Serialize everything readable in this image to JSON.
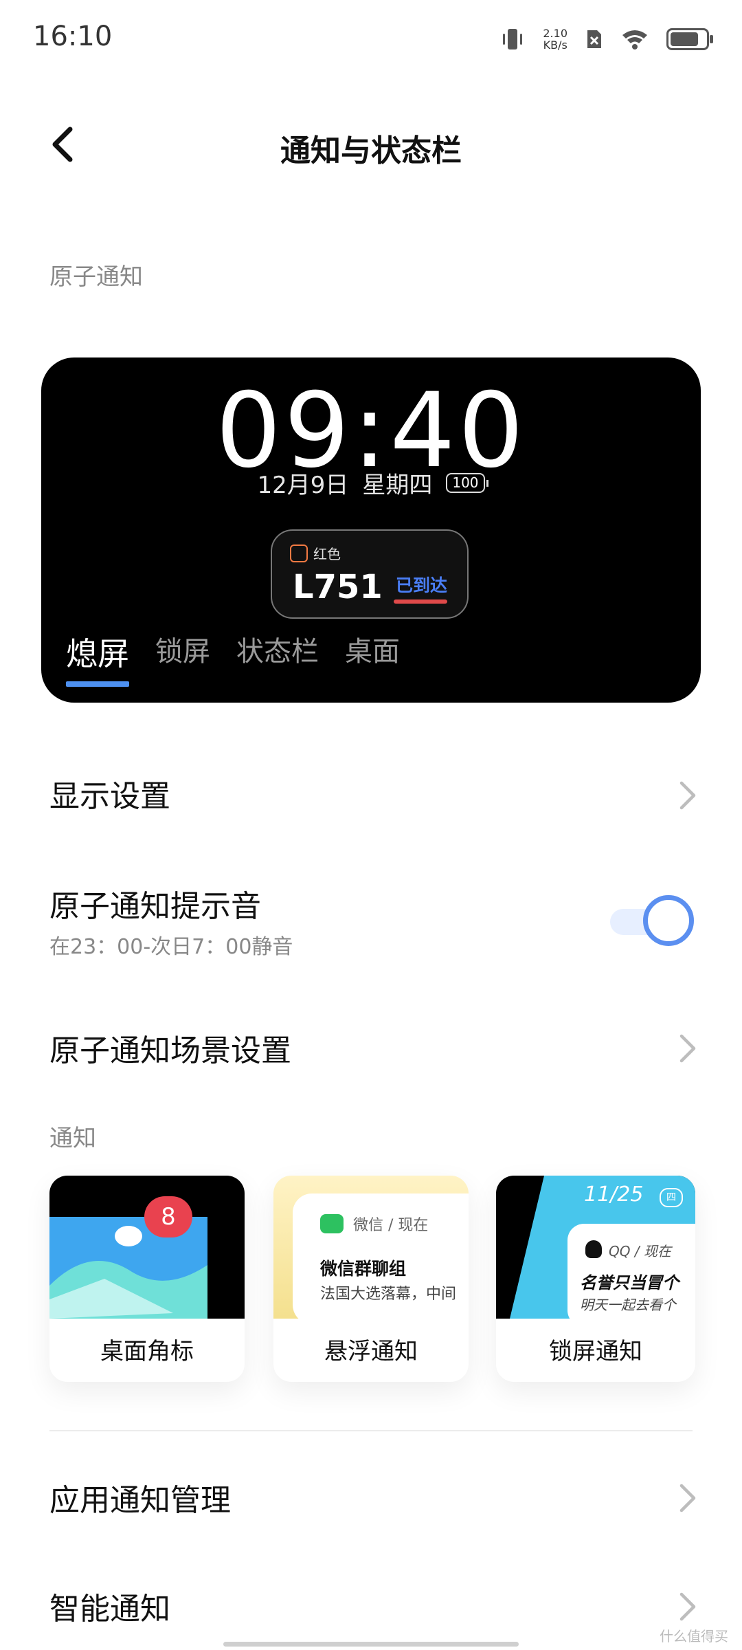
{
  "status_bar": {
    "time": "16:10",
    "net_speed_value": "2.10",
    "net_speed_unit": "KB/s",
    "battery_level": 0.8
  },
  "header": {
    "title": "通知与状态栏"
  },
  "atomic_section": {
    "label": "原子通知",
    "preview": {
      "clock": "09:40",
      "date": "12月9日",
      "weekday": "星期四",
      "battery": "100",
      "pill": {
        "app_name": "红色",
        "code": "L751",
        "status": "已到达"
      },
      "tabs": [
        "熄屏",
        "锁屏",
        "状态栏",
        "桌面"
      ],
      "active_tab": 0
    }
  },
  "settings": {
    "display": {
      "title": "显示设置"
    },
    "sound": {
      "title": "原子通知提示音",
      "subtitle": "在23：00-次日7：00静音",
      "enabled": true
    },
    "scene": {
      "title": "原子通知场景设置"
    }
  },
  "notify_section": {
    "label": "通知",
    "cards": [
      {
        "label": "桌面角标",
        "badge_count": "8"
      },
      {
        "label": "悬浮通知",
        "app": "微信 / 现在",
        "title": "微信群聊组",
        "body": "法国大选落幕，中间"
      },
      {
        "label": "锁屏通知",
        "date": "11/25",
        "weekday": "四",
        "app": "QQ / 现在",
        "title": "名誉只当冒个",
        "body": "明天一起去看个"
      }
    ]
  },
  "more": {
    "app_manage": {
      "title": "应用通知管理"
    },
    "smart": {
      "title": "智能通知"
    }
  },
  "watermark": "什么值得买",
  "colors": {
    "accent": "#4d90f0",
    "toggle": "#5b8ff0",
    "card_bg": "#000000"
  }
}
